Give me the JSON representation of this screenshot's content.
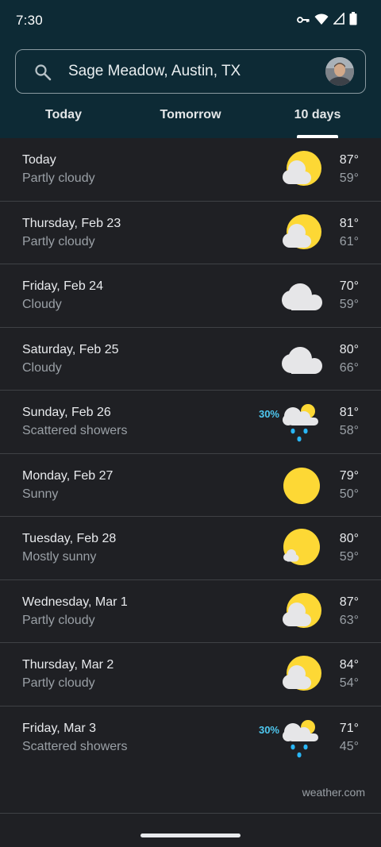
{
  "status_bar": {
    "time": "7:30",
    "icons": [
      "vpn-key-icon",
      "wifi-icon",
      "cellular-signal-icon",
      "battery-icon"
    ]
  },
  "search": {
    "location": "Sage Meadow, Austin, TX",
    "icon": "search-icon"
  },
  "tabs": [
    {
      "label": "Today",
      "selected": false
    },
    {
      "label": "Tomorrow",
      "selected": false
    },
    {
      "label": "10 days",
      "selected": true
    }
  ],
  "forecast": [
    {
      "day": "Today",
      "condition": "Partly cloudy",
      "high": "87°",
      "low": "59°",
      "icon": "partly-cloudy-icon",
      "precip": ""
    },
    {
      "day": "Thursday, Feb 23",
      "condition": "Partly cloudy",
      "high": "81°",
      "low": "61°",
      "icon": "partly-cloudy-icon",
      "precip": ""
    },
    {
      "day": "Friday, Feb 24",
      "condition": "Cloudy",
      "high": "70°",
      "low": "59°",
      "icon": "cloudy-icon",
      "precip": ""
    },
    {
      "day": "Saturday, Feb 25",
      "condition": "Cloudy",
      "high": "80°",
      "low": "66°",
      "icon": "cloudy-icon",
      "precip": ""
    },
    {
      "day": "Sunday, Feb 26",
      "condition": "Scattered showers",
      "high": "81°",
      "low": "58°",
      "icon": "scattered-showers-icon",
      "precip": "30%"
    },
    {
      "day": "Monday, Feb 27",
      "condition": "Sunny",
      "high": "79°",
      "low": "50°",
      "icon": "sunny-icon",
      "precip": ""
    },
    {
      "day": "Tuesday, Feb 28",
      "condition": "Mostly sunny",
      "high": "80°",
      "low": "59°",
      "icon": "mostly-sunny-icon",
      "precip": ""
    },
    {
      "day": "Wednesday, Mar 1",
      "condition": "Partly cloudy",
      "high": "87°",
      "low": "63°",
      "icon": "partly-cloudy-icon",
      "precip": ""
    },
    {
      "day": "Thursday, Mar 2",
      "condition": "Partly cloudy",
      "high": "84°",
      "low": "54°",
      "icon": "partly-cloudy-icon",
      "precip": ""
    },
    {
      "day": "Friday, Mar 3",
      "condition": "Scattered showers",
      "high": "71°",
      "low": "45°",
      "icon": "scattered-showers-icon",
      "precip": "30%"
    }
  ],
  "source": "weather.com",
  "colors": {
    "header_bg": "#0d2a35",
    "page_bg": "#1f2024",
    "sun": "#fdd835",
    "cloud": "#e6e6e8",
    "rain": "#29b6f6",
    "precip_text": "#4ec8f0"
  }
}
